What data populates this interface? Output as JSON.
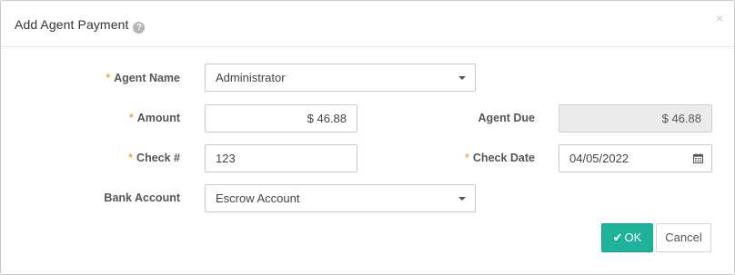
{
  "dialog": {
    "title": "Add Agent Payment",
    "help_icon": "question-circle-icon",
    "close_label": "×"
  },
  "form": {
    "agent_name": {
      "label": "Agent Name",
      "required": true,
      "value": "Administrator"
    },
    "amount": {
      "label": "Amount",
      "required": true,
      "value": "$ 46.88"
    },
    "agent_due": {
      "label": "Agent Due",
      "required": false,
      "value": "$ 46.88"
    },
    "check_no": {
      "label": "Check #",
      "required": true,
      "value": "123"
    },
    "check_date": {
      "label": "Check Date",
      "required": true,
      "value": "04/05/2022",
      "icon": "calendar-icon"
    },
    "bank_account": {
      "label": "Bank Account",
      "required": false,
      "value": "Escrow Account"
    },
    "required_marker": "*"
  },
  "buttons": {
    "ok": "OK",
    "ok_icon": "check-icon",
    "cancel": "Cancel"
  },
  "colors": {
    "primary": "#1fb29a",
    "required": "#f0ad4e",
    "disabled_bg": "#ebebeb"
  }
}
